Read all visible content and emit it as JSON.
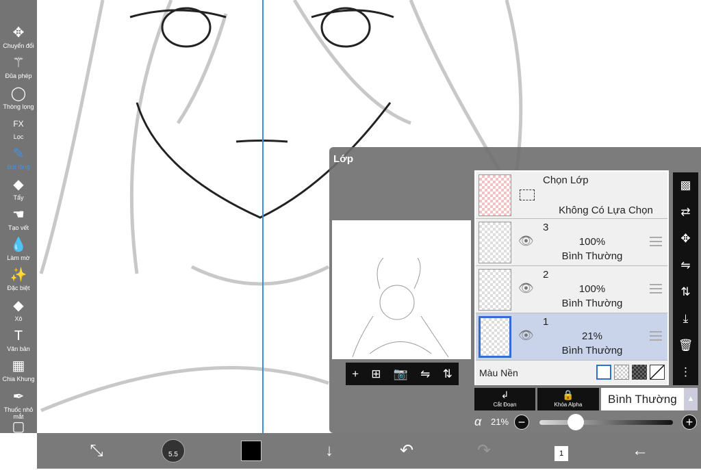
{
  "toolbar": {
    "items": [
      {
        "label": "Chuyển đổi",
        "icon": "move-icon",
        "glyph": "✥"
      },
      {
        "label": "Đũa phép",
        "icon": "magic-wand-icon",
        "glyph": "⚚"
      },
      {
        "label": "Thòng lọng",
        "icon": "lasso-icon",
        "glyph": "◯"
      },
      {
        "label": "Lọc",
        "icon": "fx-icon",
        "glyph": "FX"
      },
      {
        "label": "Bút lông",
        "icon": "brush-icon",
        "glyph": "✎",
        "active": true
      },
      {
        "label": "Tẩy",
        "icon": "eraser-icon",
        "glyph": "◆"
      },
      {
        "label": "Tạo vết",
        "icon": "smudge-icon",
        "glyph": "☚"
      },
      {
        "label": "Làm mờ",
        "icon": "blur-icon",
        "glyph": "💧"
      },
      {
        "label": "Đặc biệt",
        "icon": "special-icon",
        "glyph": "✨"
      },
      {
        "label": "Xô",
        "icon": "bucket-icon",
        "glyph": "◆"
      },
      {
        "label": "Văn bản",
        "icon": "text-icon",
        "glyph": "T"
      },
      {
        "label": "Chia Khung",
        "icon": "frame-divider-icon",
        "glyph": "▦"
      },
      {
        "label": "Thuốc nhỏ mắt",
        "icon": "eyedropper-icon",
        "glyph": "✒"
      },
      {
        "label": "Tấm vải",
        "icon": "canvas-icon",
        "glyph": "▢"
      }
    ]
  },
  "bottombar": {
    "brush_size": "5.5",
    "color": "#000000",
    "layer_count": "1"
  },
  "panel": {
    "title": "Lớp",
    "selection": {
      "title": "Chọn Lớp",
      "subtitle": "Không Có Lựa Chọn"
    },
    "layers": [
      {
        "name": "3",
        "opacity": "100%",
        "mode": "Bình Thường",
        "selected": false
      },
      {
        "name": "2",
        "opacity": "100%",
        "mode": "Bình Thường",
        "selected": false
      },
      {
        "name": "1",
        "opacity": "21%",
        "mode": "Bình Thường",
        "selected": true
      }
    ],
    "background_label": "Màu Nền",
    "clip_label": "Cắt Đoạn",
    "alpha_lock_label": "Khóa Alpha",
    "blend_mode": "Bình Thường",
    "alpha_symbol": "α",
    "alpha_value": "21%",
    "alpha_fraction": 0.21
  },
  "colors": {
    "accent": "#3d8fd6",
    "selected_layer": "#c9d4ea"
  }
}
